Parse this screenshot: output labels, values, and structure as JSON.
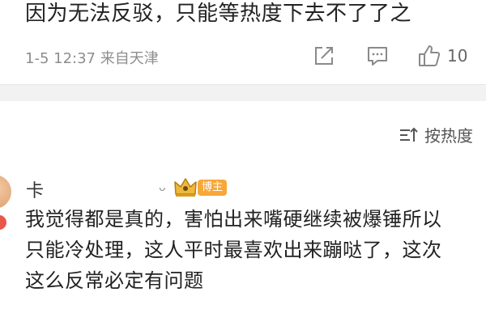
{
  "post": {
    "text": "因为无法反驳，只能等热度下去不了了之",
    "timestamp": "1-5 12:37",
    "location": "来自天津",
    "like_count": "10",
    "icons": {
      "share": "share-icon",
      "comment": "comment-icon",
      "like": "thumbs-up-icon"
    }
  },
  "sort": {
    "label": "按热度",
    "icon": "sort-icon"
  },
  "comment": {
    "username": "卡",
    "name_tail": "ᴗ",
    "badge": "博主",
    "lines": [
      "我觉得都是真的，害怕出来嘴硬继续被爆锤所以",
      "只能冷处理，这人平时最喜欢出来蹦哒了，这次",
      "这么反常必定有问题"
    ]
  },
  "colors": {
    "text": "#222222",
    "meta": "#8d8d8d",
    "badge": "#f6a83a",
    "separator": "#f2f2f2"
  }
}
